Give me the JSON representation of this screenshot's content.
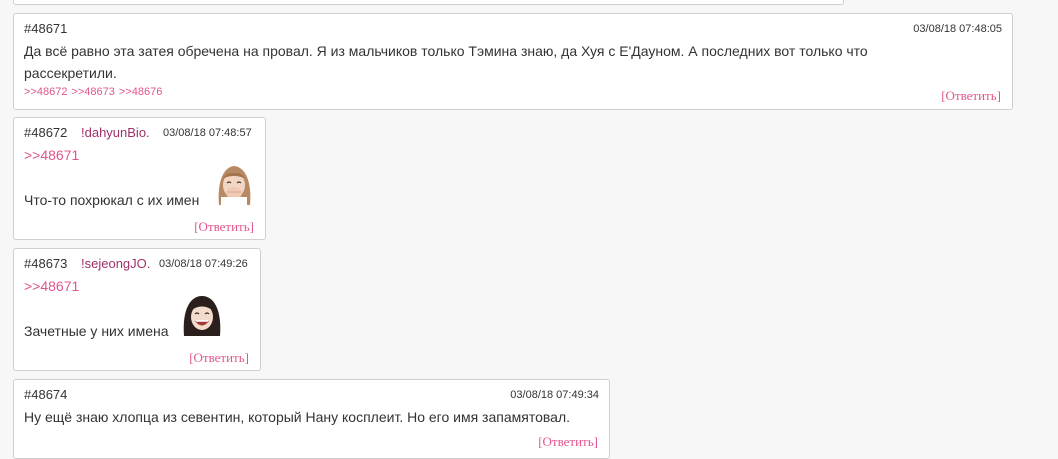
{
  "posts": [
    {
      "id": "#48671",
      "time": "03/08/18 07:48:05",
      "text_line1": "Да всё равно эта затея обречена на провал. Я из мальчиков только Тэмина знаю, да Хуя с Е'Дауном. А последних вот только что",
      "text_line2": "рассекретили.",
      "backlinks": [
        ">>48672",
        ">>48673",
        ">>48676"
      ],
      "reply_label": "[Ответить]"
    },
    {
      "id": "#48672",
      "trip": "!dahyunBio.",
      "time": "03/08/18 07:48:57",
      "quote": ">>48671",
      "text": "Что-то похрюкал с их имен",
      "sticker_icon": "laughing-girl-sticker-icon",
      "reply_label": "[Ответить]"
    },
    {
      "id": "#48673",
      "trip": "!sejeongJO.",
      "time": "03/08/18 07:49:26",
      "quote": ">>48671",
      "text": "Зачетные у них имена",
      "sticker_icon": "laughing-girl-sticker-icon",
      "reply_label": "[Ответить]"
    },
    {
      "id": "#48674",
      "time": "03/08/18 07:49:34",
      "text": "Ну ещё знаю хлопца из севентин, который Нану косплеит. Но его имя запамятовал.",
      "reply_label": "[Ответить]"
    }
  ]
}
